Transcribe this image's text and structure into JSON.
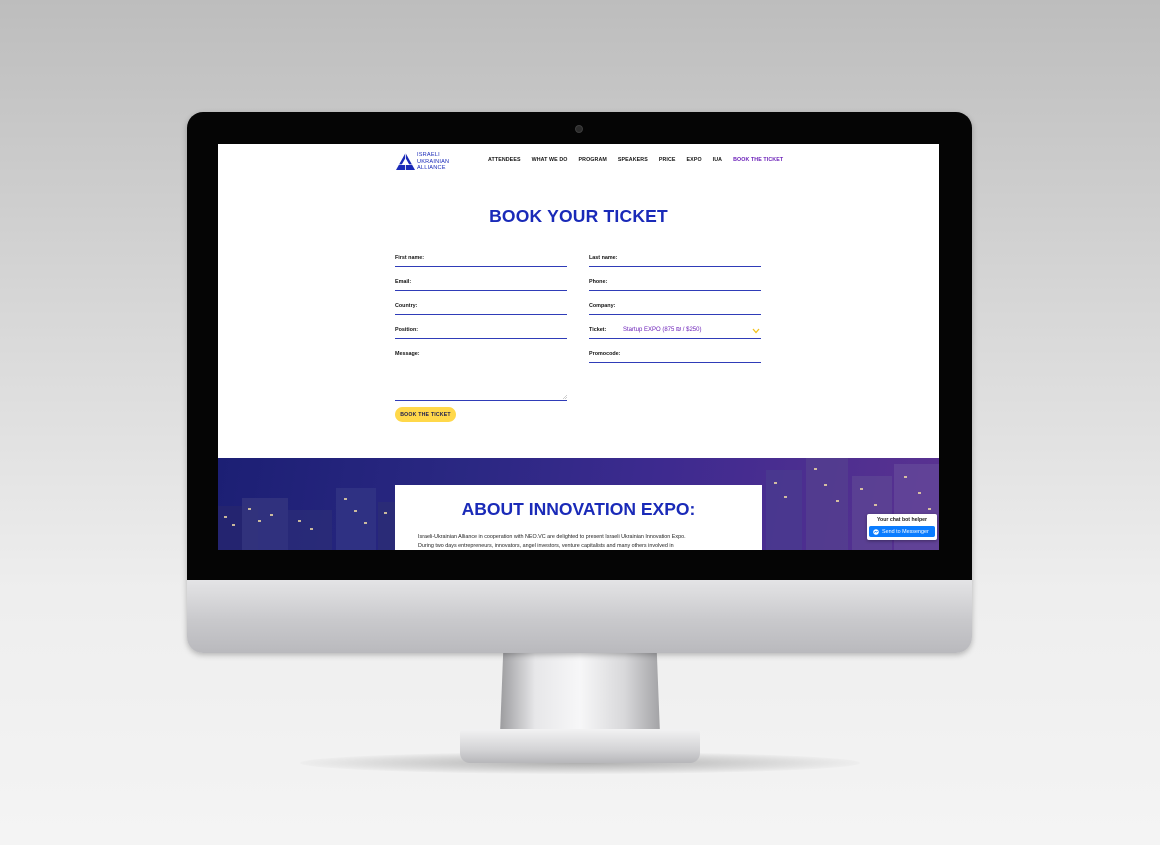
{
  "site": {
    "logo": {
      "lines": [
        "ISRAELI",
        "UKRAINIAN",
        "ALLIANCE"
      ]
    },
    "nav": [
      {
        "label": "ATTENDEES",
        "active": false
      },
      {
        "label": "WHAT WE DO",
        "active": false
      },
      {
        "label": "PROGRAM",
        "active": false
      },
      {
        "label": "SPEAKERS",
        "active": false
      },
      {
        "label": "PRICE",
        "active": false
      },
      {
        "label": "EXPO",
        "active": false
      },
      {
        "label": "IUA",
        "active": false
      },
      {
        "label": "BOOK THE TICKET",
        "active": true
      }
    ]
  },
  "booking": {
    "title": "BOOK YOUR TICKET",
    "fields": {
      "first_name": "First name:",
      "last_name": "Last name:",
      "email": "Email:",
      "phone": "Phone:",
      "country": "Country:",
      "company": "Company:",
      "position": "Position:",
      "ticket": "Ticket:",
      "ticket_value": "Startup EXPO (875 ₪ / $250)",
      "message": "Message:",
      "promocode": "Promocode:"
    },
    "submit_label": "BOOK THE TICKET"
  },
  "about": {
    "title": "ABOUT INNOVATION EXPO:",
    "lines": [
      "Israeli-Ukrainian Alliance in cooperation with NEO.VC are delighted to present Israeli Ukrainian Innovation Expo.",
      "During two days entrepreneurs, innovators, angel investors, venture capitalists and many others involved in"
    ]
  },
  "chatbot": {
    "title": "Your chat bot helper",
    "button_label": "Send to Messenger"
  },
  "colors": {
    "brand_blue": "#1a2ab8",
    "active_purple": "#6a1eb8",
    "button_yellow": "#ffd84a",
    "messenger_blue": "#0a7cff"
  }
}
